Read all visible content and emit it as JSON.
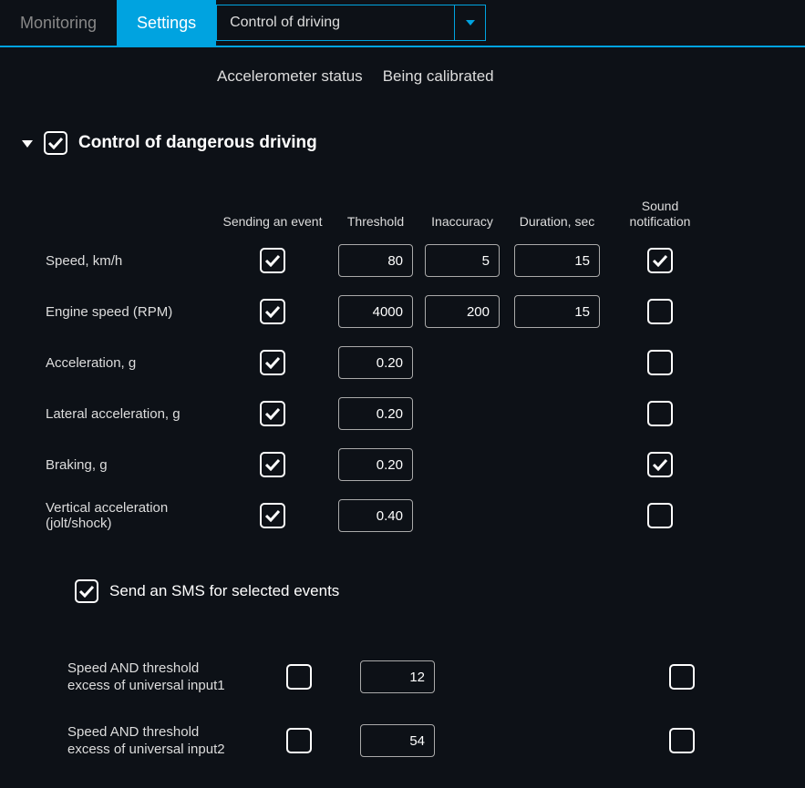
{
  "tabs": {
    "monitoring": "Monitoring",
    "settings": "Settings"
  },
  "dropdown": {
    "selected": "Control of driving"
  },
  "status": {
    "label": "Accelerometer status",
    "value": "Being calibrated"
  },
  "section": {
    "title": "Control of dangerous driving",
    "checked": true
  },
  "headers": {
    "event": "Sending an event",
    "threshold": "Threshold",
    "inaccuracy": "Inaccuracy",
    "duration": "Duration, sec",
    "sound": "Sound notification"
  },
  "rows": [
    {
      "label": "Speed, km/h",
      "event": true,
      "threshold": "80",
      "inaccuracy": "5",
      "duration": "15",
      "sound": true
    },
    {
      "label": "Engine speed (RPM)",
      "event": true,
      "threshold": "4000",
      "inaccuracy": "200",
      "duration": "15",
      "sound": false
    },
    {
      "label": "Acceleration, g",
      "event": true,
      "threshold": "0.20",
      "inaccuracy": null,
      "duration": null,
      "sound": false
    },
    {
      "label": "Lateral acceleration, g",
      "event": true,
      "threshold": "0.20",
      "inaccuracy": null,
      "duration": null,
      "sound": false
    },
    {
      "label": "Braking, g",
      "event": true,
      "threshold": "0.20",
      "inaccuracy": null,
      "duration": null,
      "sound": true
    },
    {
      "label": "Vertical acceleration (jolt/shock)",
      "event": true,
      "threshold": "0.40",
      "inaccuracy": null,
      "duration": null,
      "sound": false
    }
  ],
  "sms": {
    "title": "Send an SMS for selected events",
    "checked": true,
    "rows": [
      {
        "label": "Speed AND threshold excess of universal input1",
        "event": false,
        "value": "12",
        "sound": false
      },
      {
        "label": "Speed AND threshold excess of universal input2",
        "event": false,
        "value": "54",
        "sound": false
      }
    ]
  }
}
